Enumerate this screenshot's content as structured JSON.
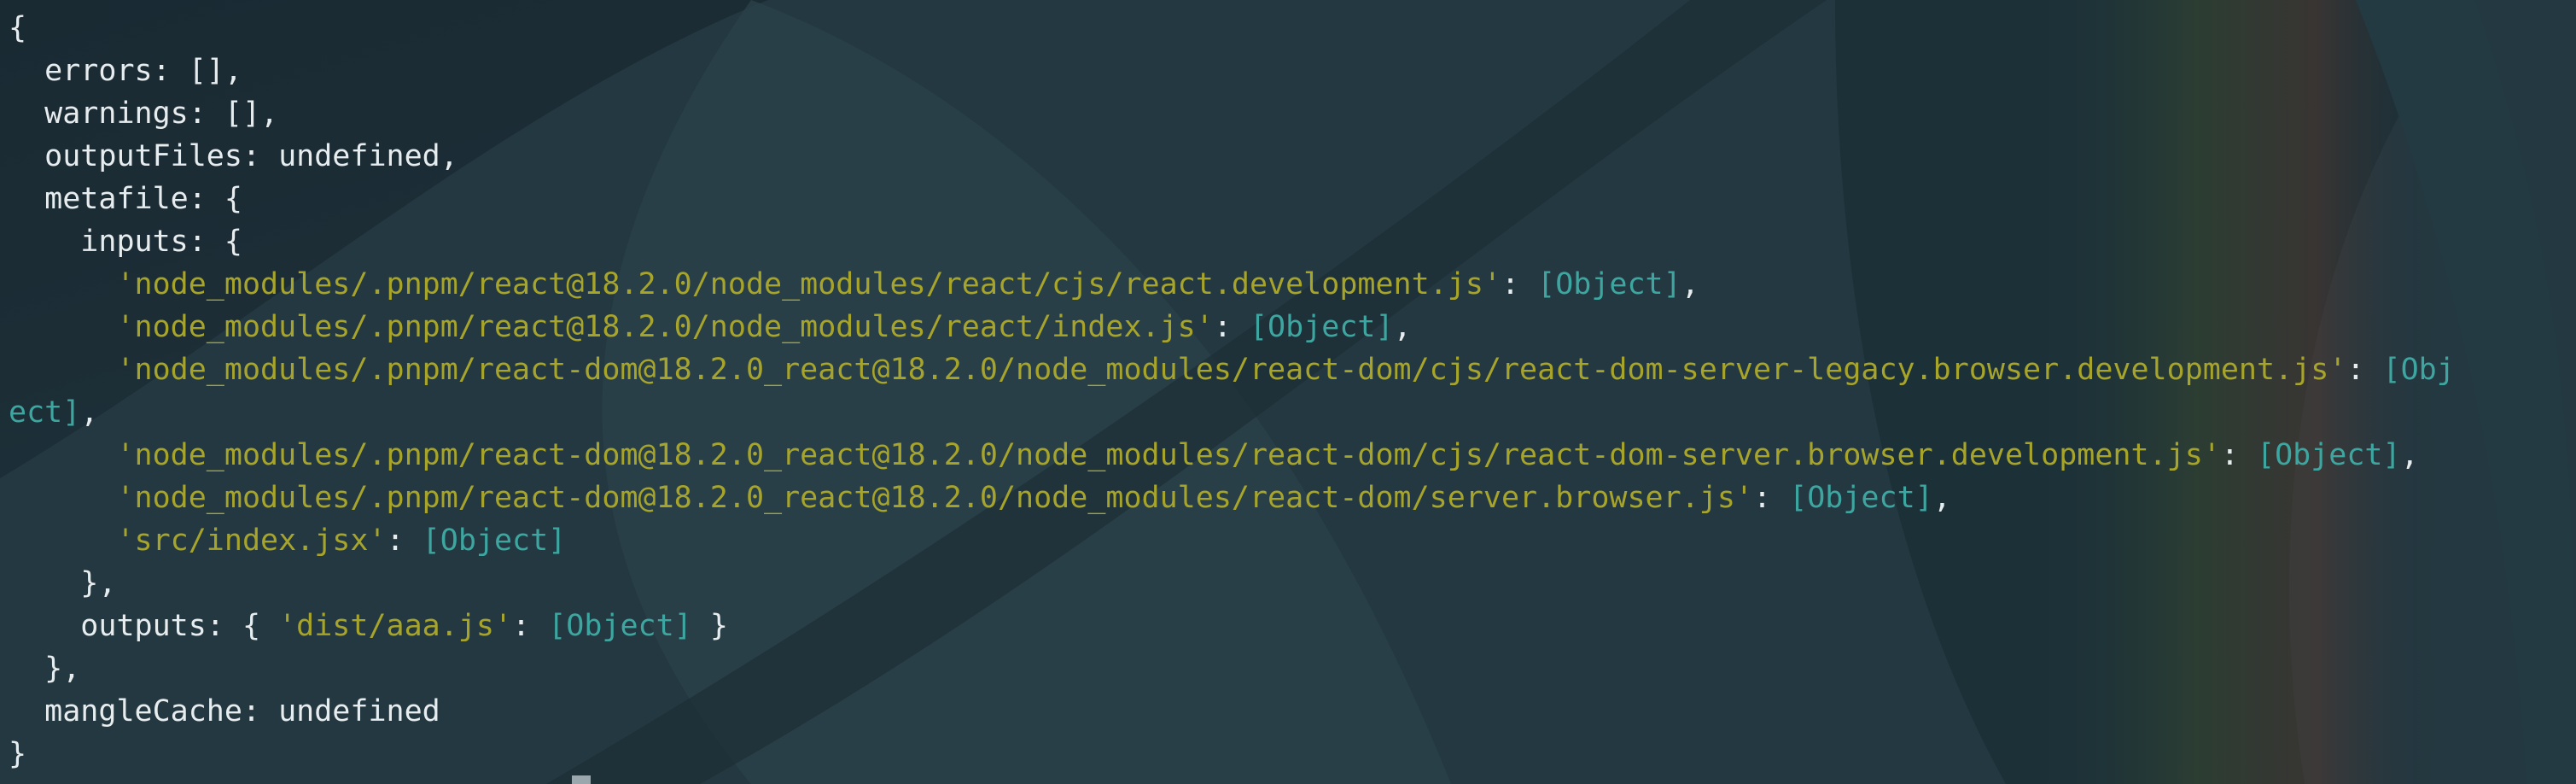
{
  "terminal": {
    "lines": [
      {
        "indent": "",
        "parts": [
          {
            "t": "{",
            "c": "punc"
          }
        ]
      },
      {
        "indent": "  ",
        "parts": [
          {
            "t": "errors: [],",
            "c": "punc"
          }
        ]
      },
      {
        "indent": "  ",
        "parts": [
          {
            "t": "warnings: [],",
            "c": "punc"
          }
        ]
      },
      {
        "indent": "  ",
        "parts": [
          {
            "t": "outputFiles: undefined,",
            "c": "punc"
          }
        ]
      },
      {
        "indent": "  ",
        "parts": [
          {
            "t": "metafile: {",
            "c": "punc"
          }
        ]
      },
      {
        "indent": "    ",
        "parts": [
          {
            "t": "inputs: {",
            "c": "punc"
          }
        ]
      },
      {
        "indent": "      ",
        "parts": [
          {
            "t": "'node_modules/.pnpm/react@18.2.0/node_modules/react/cjs/react.development.js'",
            "c": "str"
          },
          {
            "t": ": ",
            "c": "punc"
          },
          {
            "t": "[Object]",
            "c": "obj"
          },
          {
            "t": ",",
            "c": "punc"
          }
        ]
      },
      {
        "indent": "      ",
        "parts": [
          {
            "t": "'node_modules/.pnpm/react@18.2.0/node_modules/react/index.js'",
            "c": "str"
          },
          {
            "t": ": ",
            "c": "punc"
          },
          {
            "t": "[Object]",
            "c": "obj"
          },
          {
            "t": ",",
            "c": "punc"
          }
        ]
      },
      {
        "indent": "      ",
        "parts": [
          {
            "t": "'node_modules/.pnpm/react-dom@18.2.0_react@18.2.0/node_modules/react-dom/cjs/react-dom-server-legacy.browser.development.js'",
            "c": "str"
          },
          {
            "t": ": ",
            "c": "punc"
          },
          {
            "t": "[Obj",
            "c": "obj"
          }
        ]
      },
      {
        "indent": "",
        "parts": [
          {
            "t": "ect]",
            "c": "obj"
          },
          {
            "t": ",",
            "c": "punc"
          }
        ]
      },
      {
        "indent": "      ",
        "parts": [
          {
            "t": "'node_modules/.pnpm/react-dom@18.2.0_react@18.2.0/node_modules/react-dom/cjs/react-dom-server.browser.development.js'",
            "c": "str"
          },
          {
            "t": ": ",
            "c": "punc"
          },
          {
            "t": "[Object]",
            "c": "obj"
          },
          {
            "t": ",",
            "c": "punc"
          }
        ]
      },
      {
        "indent": "      ",
        "parts": [
          {
            "t": "'node_modules/.pnpm/react-dom@18.2.0_react@18.2.0/node_modules/react-dom/server.browser.js'",
            "c": "str"
          },
          {
            "t": ": ",
            "c": "punc"
          },
          {
            "t": "[Object]",
            "c": "obj"
          },
          {
            "t": ",",
            "c": "punc"
          }
        ]
      },
      {
        "indent": "      ",
        "parts": [
          {
            "t": "'src/index.jsx'",
            "c": "str"
          },
          {
            "t": ": ",
            "c": "punc"
          },
          {
            "t": "[Object]",
            "c": "obj"
          }
        ]
      },
      {
        "indent": "    ",
        "parts": [
          {
            "t": "},",
            "c": "punc"
          }
        ]
      },
      {
        "indent": "    ",
        "parts": [
          {
            "t": "outputs: { ",
            "c": "punc"
          },
          {
            "t": "'dist/aaa.js'",
            "c": "str"
          },
          {
            "t": ": ",
            "c": "punc"
          },
          {
            "t": "[Object]",
            "c": "obj"
          },
          {
            "t": " }",
            "c": "punc"
          }
        ]
      },
      {
        "indent": "  ",
        "parts": [
          {
            "t": "},",
            "c": "punc"
          }
        ]
      },
      {
        "indent": "  ",
        "parts": [
          {
            "t": "mangleCache: undefined",
            "c": "punc"
          }
        ]
      },
      {
        "indent": "",
        "parts": [
          {
            "t": "}",
            "c": "punc"
          }
        ]
      }
    ]
  },
  "colors": {
    "background": "#1f3039",
    "text": "#e7ecee",
    "string": "#a7a42b",
    "object_tag": "#3ea6a0"
  }
}
